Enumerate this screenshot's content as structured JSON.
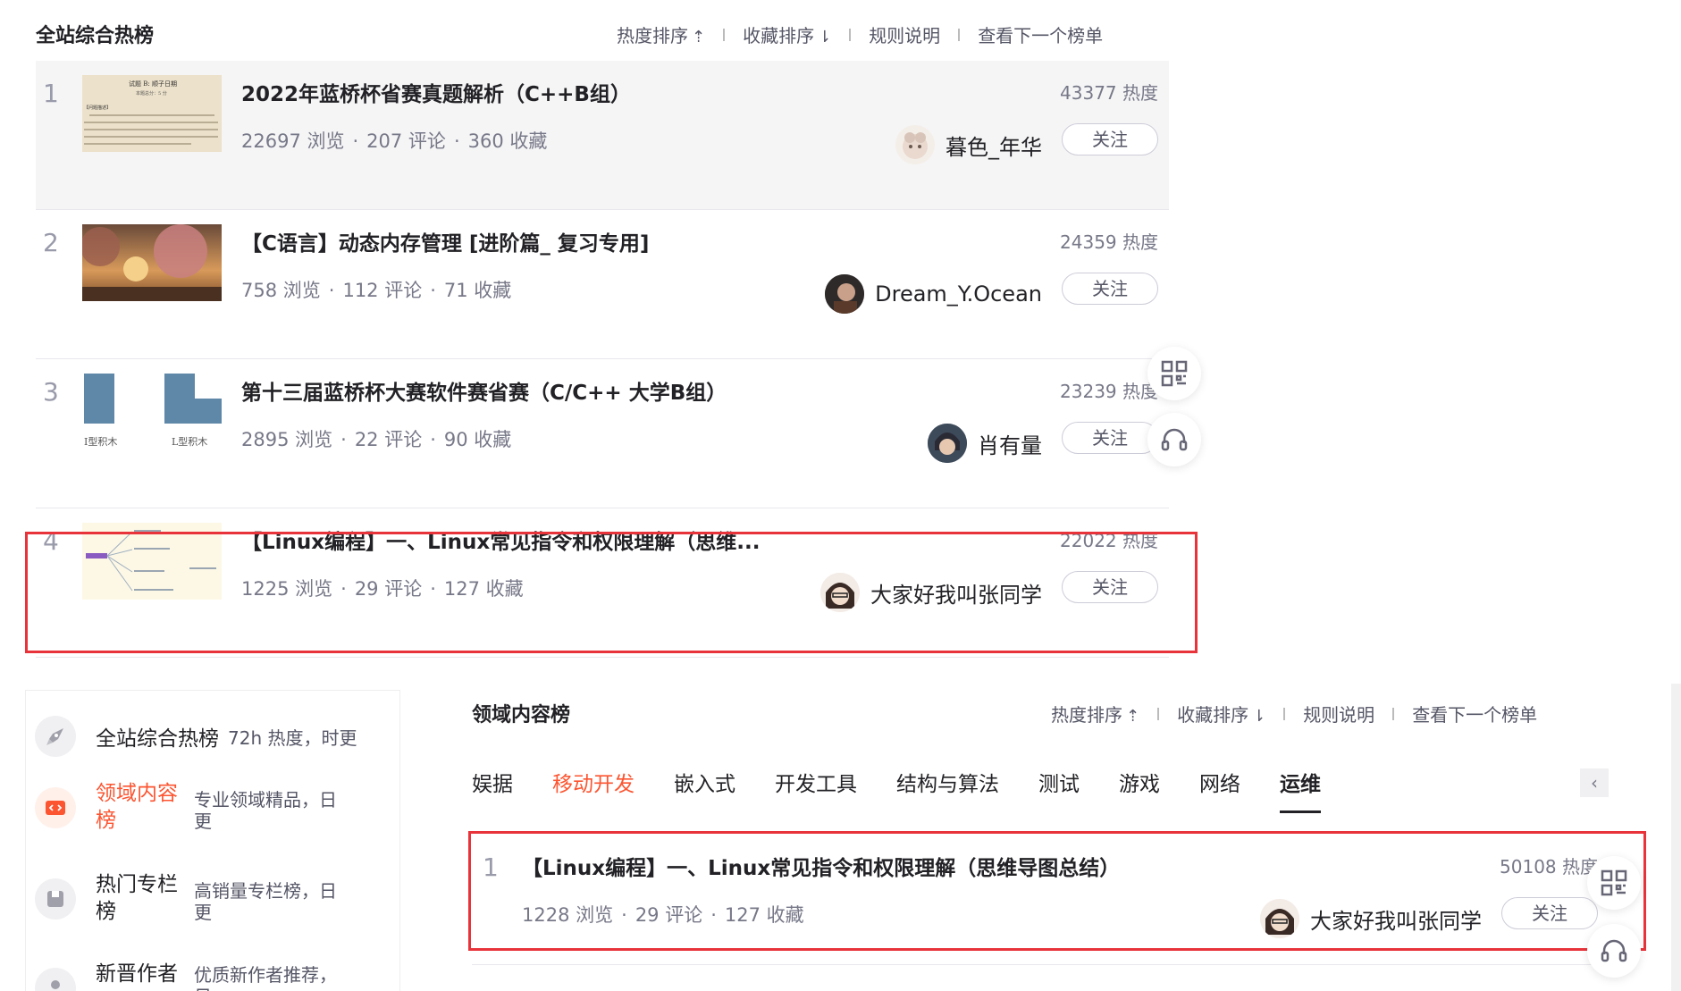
{
  "top": {
    "title": "全站综合热榜",
    "toolbar": {
      "sort_heat": "热度排序",
      "sort_heat_icon": "⇡",
      "sort_fav": "收藏排序",
      "sort_fav_icon": "⇂",
      "rules": "规则说明",
      "next": "查看下一个榜单"
    },
    "rows": [
      {
        "rank": "1",
        "title": "2022年蓝桥杯省赛真题解析（C++B组）",
        "views": "22697 浏览",
        "comments": "207 评论",
        "favs": "360 收藏",
        "heat": "43377 热度",
        "author": "暮色_年华",
        "follow": "关注",
        "thumb_text_1": "试题 B: 顺子日期",
        "thumb_text_2": "本题总分：5 分",
        "thumb_text_3": "【问题描述】"
      },
      {
        "rank": "2",
        "title": "【C语言】动态内存管理 [进阶篇_ 复习专用]",
        "views": "758 浏览",
        "comments": "112 评论",
        "favs": "71 收藏",
        "heat": "24359 热度",
        "author": "Dream_Y.Ocean",
        "follow": "关注"
      },
      {
        "rank": "3",
        "title": "第十三届蓝桥杯大赛软件赛省赛（C/C++ 大学B组）",
        "views": "2895 浏览",
        "comments": "22 评论",
        "favs": "90 收藏",
        "heat": "23239 热度",
        "author": "肖有量",
        "follow": "关注",
        "thumb_label_1": "I型积木",
        "thumb_label_2": "L型积木"
      },
      {
        "rank": "4",
        "title": "【Linux编程】一、Linux常见指令和权限理解（思维...",
        "views": "1225 浏览",
        "comments": "29 评论",
        "favs": "127 收藏",
        "heat": "22022 热度",
        "author": "大家好我叫张同学",
        "follow": "关注"
      }
    ]
  },
  "side_icons": {
    "qr": "qr-code-icon",
    "support": "headset-icon"
  },
  "left_panel": {
    "items": [
      {
        "name": "全站综合热榜",
        "desc": "72h 热度，时更",
        "icon": "rocket-icon"
      },
      {
        "name": "领域内容榜",
        "desc": "专业领域精品，日更",
        "icon": "code-icon",
        "color": "#fc5531"
      },
      {
        "name": "热门专栏榜",
        "desc": "高销量专栏榜，日更",
        "icon": "column-icon"
      },
      {
        "name": "新晋作者",
        "desc": "优质新作者推荐，日",
        "icon": "user-icon"
      }
    ]
  },
  "domain": {
    "title": "领域内容榜",
    "toolbar": {
      "sort_heat": "热度排序",
      "sort_heat_icon": "⇡",
      "sort_fav": "收藏排序",
      "sort_fav_icon": "⇂",
      "rules": "规则说明",
      "next": "查看下一个榜单"
    },
    "tabs": [
      "娱据",
      "移动开发",
      "嵌入式",
      "开发工具",
      "结构与算法",
      "测试",
      "游戏",
      "网络",
      "运维"
    ],
    "active_tab": "运维",
    "highlight_tab": "移动开发",
    "row": {
      "rank": "1",
      "title": "【Linux编程】一、Linux常见指令和权限理解（思维导图总结）",
      "views": "1228 浏览",
      "comments": "29 评论",
      "favs": "127 收藏",
      "heat": "50108 热度",
      "author": "大家好我叫张同学",
      "follow": "关注"
    }
  },
  "colors": {
    "accent": "#fc5531",
    "highlight_box": "#e8333a",
    "text_muted": "#777888"
  }
}
